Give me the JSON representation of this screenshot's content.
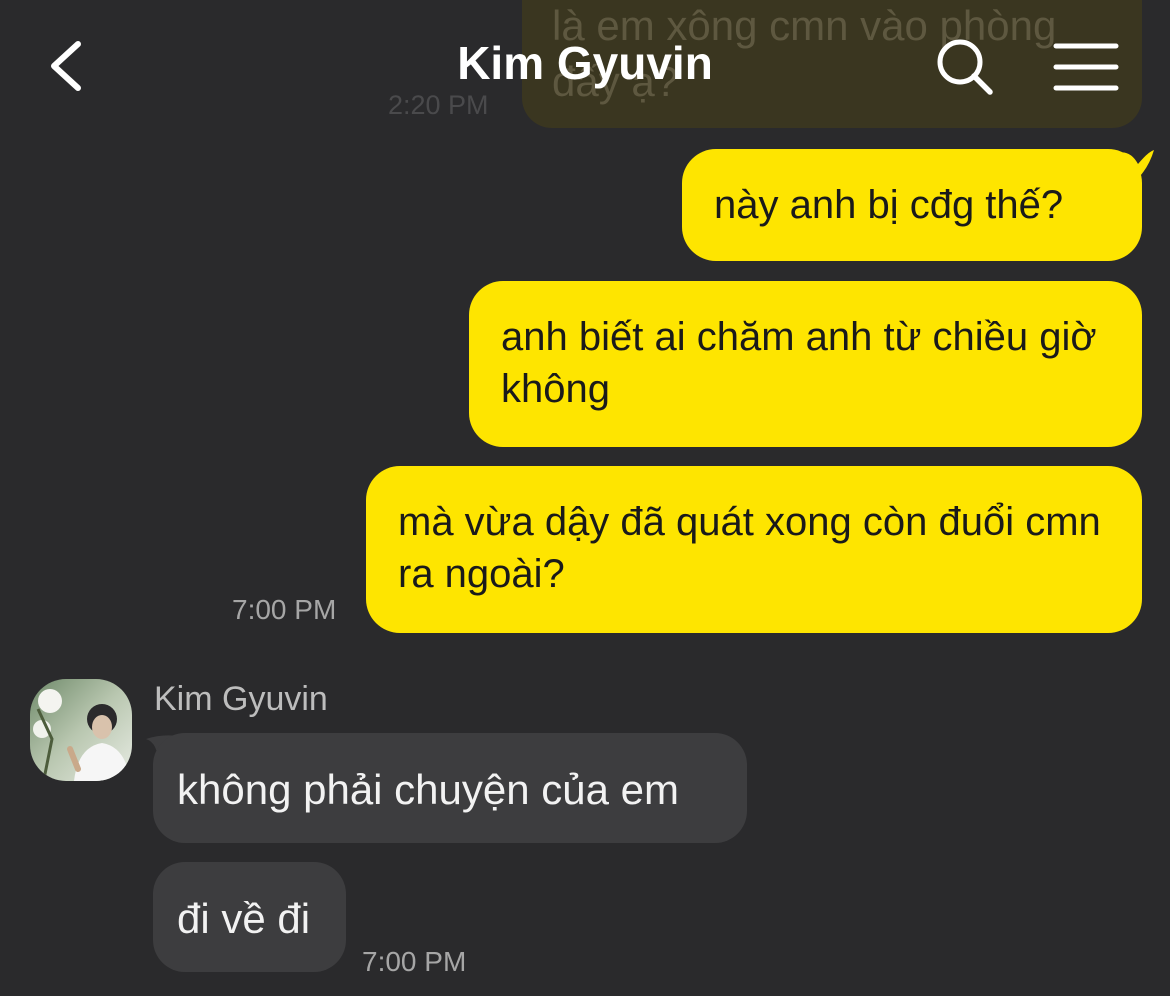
{
  "header": {
    "title": "Kim Gyuvin",
    "back_icon": "chevron-left-icon",
    "search_icon": "search-icon",
    "menu_icon": "hamburger-menu-icon"
  },
  "colors": {
    "background": "#2a2a2c",
    "outgoing_bubble": "#fee500",
    "incoming_bubble": "#3d3d3f"
  },
  "previous_message": {
    "text": "là em xông cmn vào phòng đấy ạ?",
    "time": "2:20 PM"
  },
  "outgoing_group": {
    "messages": [
      {
        "text": "này anh bị cđg thế?"
      },
      {
        "text": "anh biết ai chăm anh từ chiều giờ không"
      },
      {
        "text": "mà vừa dậy đã quát xong còn đuổi cmn ra ngoài?"
      }
    ],
    "time": "7:00 PM"
  },
  "incoming_group": {
    "sender": "Kim Gyuvin",
    "messages": [
      {
        "text": "không phải chuyện của em"
      },
      {
        "text": "đi về đi"
      }
    ],
    "time": "7:00 PM"
  }
}
